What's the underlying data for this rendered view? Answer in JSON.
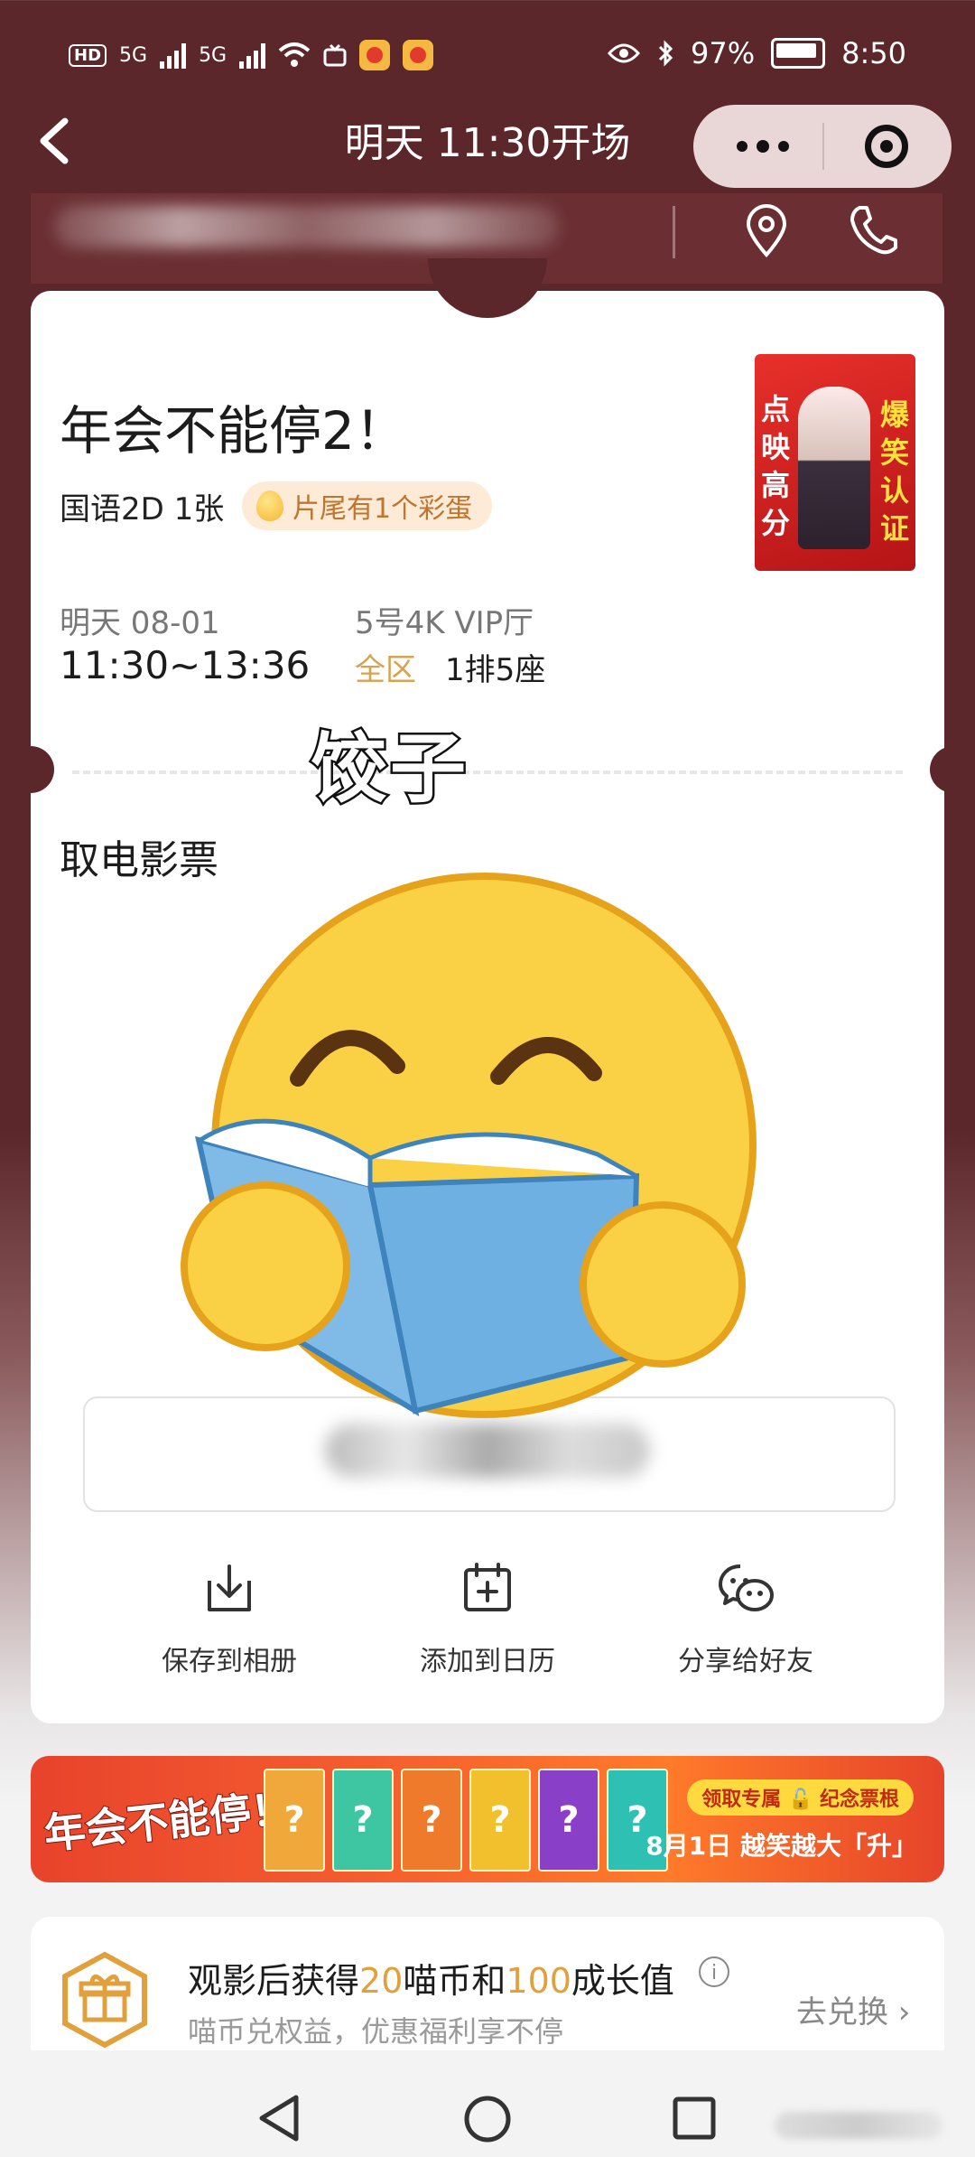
{
  "status_bar": {
    "hd": "HD",
    "sig1": "5G",
    "sig2": "5G",
    "battery": "97%",
    "time": "8:50"
  },
  "nav": {
    "title": "明天 11:30开场"
  },
  "movie": {
    "title": "年会不能停2！",
    "format": "国语2D 1张",
    "egg_tag": "片尾有1个彩蛋",
    "date": "明天 08-01",
    "time": "11:30~13:36",
    "hall": "5号4K VIP厅",
    "area": "全区",
    "seat": "1排5座"
  },
  "poster": {
    "left_text": "点映高分",
    "right_text": "爆笑认证"
  },
  "sticker": {
    "text": "饺子"
  },
  "ticket": {
    "section_title": "取电影票"
  },
  "actions": [
    {
      "label": "保存到相册",
      "icon": "download-icon"
    },
    {
      "label": "添加到日历",
      "icon": "calendar-add-icon"
    },
    {
      "label": "分享给好友",
      "icon": "wechat-icon"
    }
  ],
  "banner": {
    "logo": "年会不能停！",
    "cards": [
      "?",
      "?",
      "?",
      "?",
      "?",
      "?"
    ],
    "pill": "领取专属 🔓 纪念票根",
    "date_text": "8月1日 越笑越大「升」"
  },
  "reward": {
    "title_pre": "观影后获得",
    "coins": "20",
    "title_mid": "喵币和",
    "growth": "100",
    "title_post": "成长值",
    "subtitle": "喵币兑权益，优惠福利享不停",
    "exchange": "去兑换 ›"
  },
  "colors": {
    "header_bg": "#5c272a",
    "gold": "#d7a251",
    "reward_highlight": "#e2a03d"
  }
}
